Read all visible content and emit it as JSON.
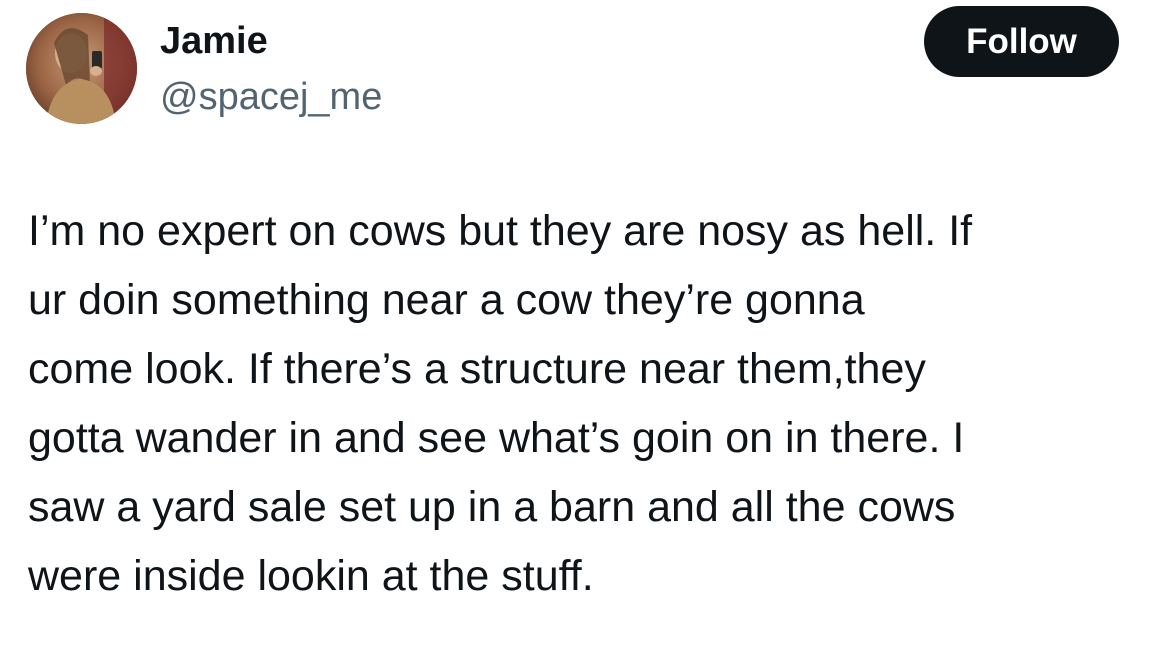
{
  "author": {
    "display_name": "Jamie",
    "handle": "@spacej_me"
  },
  "follow_button": {
    "label": "Follow"
  },
  "tweet": {
    "text": "I’m no expert on cows but they are nosy as hell. If\nur doin something near a cow they’re gonna\ncome look. If there’s a structure near them,they\ngotta wander in and see what’s goin on in there. I\nsaw a yard sale set up in a barn and all the cows\nwere inside lookin at the stuff."
  },
  "colors": {
    "primary_text": "#0f1419",
    "secondary_text": "#536471",
    "button_bg": "#0f1419",
    "button_text": "#ffffff",
    "background": "#ffffff"
  }
}
